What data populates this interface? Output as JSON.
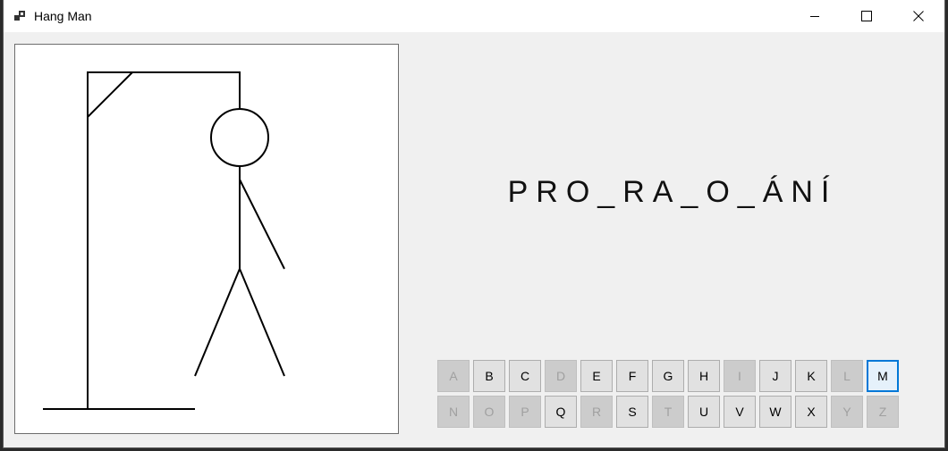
{
  "window": {
    "title": "Hang Man"
  },
  "word": {
    "display": "PRO_RA_O_ÁNÍ"
  },
  "keyboard": {
    "rows": [
      [
        {
          "label": "A",
          "enabled": false
        },
        {
          "label": "B",
          "enabled": true
        },
        {
          "label": "C",
          "enabled": true
        },
        {
          "label": "D",
          "enabled": false
        },
        {
          "label": "E",
          "enabled": true
        },
        {
          "label": "F",
          "enabled": true
        },
        {
          "label": "G",
          "enabled": true
        },
        {
          "label": "H",
          "enabled": true
        },
        {
          "label": "I",
          "enabled": false
        },
        {
          "label": "J",
          "enabled": true
        },
        {
          "label": "K",
          "enabled": true
        },
        {
          "label": "L",
          "enabled": false
        },
        {
          "label": "M",
          "enabled": true,
          "focused": true
        }
      ],
      [
        {
          "label": "N",
          "enabled": false
        },
        {
          "label": "O",
          "enabled": false
        },
        {
          "label": "P",
          "enabled": false
        },
        {
          "label": "Q",
          "enabled": true
        },
        {
          "label": "R",
          "enabled": false
        },
        {
          "label": "S",
          "enabled": true
        },
        {
          "label": "T",
          "enabled": false
        },
        {
          "label": "U",
          "enabled": true
        },
        {
          "label": "V",
          "enabled": true
        },
        {
          "label": "W",
          "enabled": true
        },
        {
          "label": "X",
          "enabled": true
        },
        {
          "label": "Y",
          "enabled": false
        },
        {
          "label": "Z",
          "enabled": false
        }
      ]
    ]
  },
  "colors": {
    "accent": "#0078d7",
    "disabled_key": "#cccccc",
    "enabled_key": "#e1e1e1"
  }
}
